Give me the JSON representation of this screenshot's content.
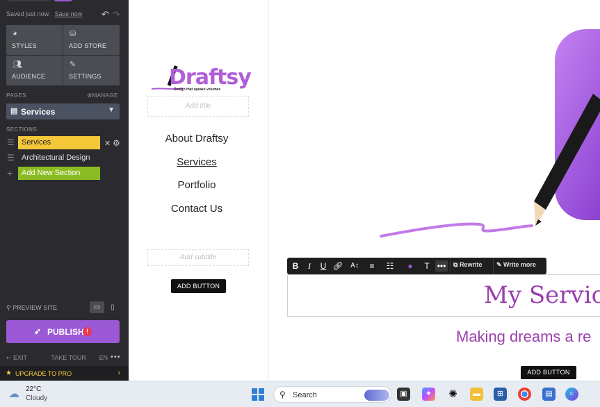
{
  "editor": {
    "saved_status": "Saved just now.",
    "save_now_link": "Save now",
    "tiles": [
      {
        "label": "STYLES",
        "icon": "palette-icon"
      },
      {
        "label": "ADD STORE",
        "icon": "store-icon"
      },
      {
        "label": "AUDIENCE",
        "icon": "people-icon"
      },
      {
        "label": "SETTINGS",
        "icon": "wrench-icon"
      }
    ],
    "pages_heading": "PAGES",
    "manage_label": "MANAGE",
    "current_page": "Services",
    "sections_heading": "SECTIONS",
    "sections": [
      {
        "label": "Services",
        "state": "active"
      },
      {
        "label": "Architectural Design",
        "state": "plain"
      }
    ],
    "add_section_label": "Add New Section",
    "preview_label": "PREVIEW SITE",
    "publish_label": "PUBLISH",
    "publish_alert": "!",
    "exit_label": "EXIT",
    "take_tour_label": "TAKE TOUR",
    "language": "EN",
    "more_label": "•••",
    "upgrade_label": "UPGRADE TO PRO",
    "accent_color": "#9b59d6",
    "active_section_color": "#f5c83a",
    "add_section_color": "#8cbc23"
  },
  "site": {
    "brand_name": "Draftsy",
    "brand_tagline": "Design that speaks volumes",
    "title_placeholder": "Add title",
    "nav": [
      "About Draftsy",
      "Services",
      "Portfolio",
      "Contact Us"
    ],
    "subtitle_placeholder": "Add subtitle",
    "add_button_label": "ADD BUTTON",
    "hero_title": "My Service",
    "hero_subtitle": "Making dreams a re",
    "hero_button_label": "ADD BUTTON",
    "hero_text_color": "#9b3faf"
  },
  "format_toolbar": {
    "buttons": [
      "B",
      "I",
      "U"
    ],
    "rewrite_label": "Rewrite",
    "write_more_label": "Write more"
  },
  "taskbar": {
    "temperature": "22°C",
    "condition": "Cloudy",
    "search_label": "Search"
  }
}
